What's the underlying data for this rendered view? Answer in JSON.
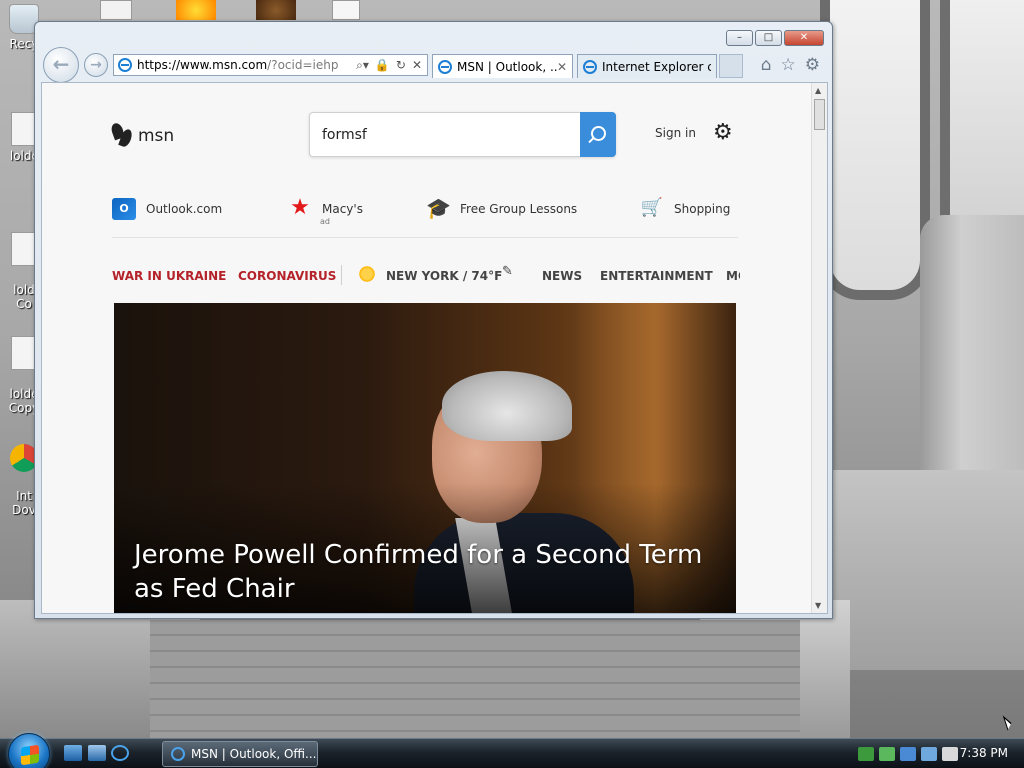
{
  "desktop": {
    "icons": [
      {
        "label": "Recy"
      },
      {
        "label": "loldc"
      },
      {
        "label": "lold\nCo"
      },
      {
        "label": "lolde\nCopy"
      },
      {
        "label": "Int\nDov"
      }
    ]
  },
  "browser": {
    "address_host": "https://www.msn.com",
    "address_path": "/?ocid=iehp",
    "tabs": [
      {
        "label": "MSN | Outlook, ...",
        "close": "✕"
      },
      {
        "label": "Internet Explorer ca..."
      }
    ],
    "window_controls": {
      "minimize": "–",
      "maximize": "□",
      "close": "✕"
    },
    "icons": {
      "back": "back-arrow-icon",
      "forward": "forward-arrow-icon",
      "home": "home-icon",
      "favorites": "star-icon",
      "tools": "gear-icon"
    }
  },
  "msn": {
    "brand": "msn",
    "search_value": "formsf",
    "sign_in": "Sign in",
    "quick_links": [
      {
        "label": "Outlook.com"
      },
      {
        "label": "Macy's",
        "ad": "ad"
      },
      {
        "label": "Free Group Lessons"
      },
      {
        "label": "Shopping"
      }
    ],
    "nav": {
      "war_in_ukraine": "WAR IN UKRAINE",
      "coronavirus": "CORONAVIRUS",
      "weather": "NEW YORK / 74°F",
      "news": "NEWS",
      "entertainment": "ENTERTAINMENT",
      "more": "MO"
    },
    "hero": {
      "title": "Jerome Powell Confirmed for a Second Term as Fed Chair"
    },
    "colors": {
      "accent_red": "#b4232a",
      "search_blue": "#3a8ddb"
    }
  },
  "taskbar": {
    "task_label": "MSN | Outlook, Offi...",
    "clock": "7:38 PM"
  }
}
